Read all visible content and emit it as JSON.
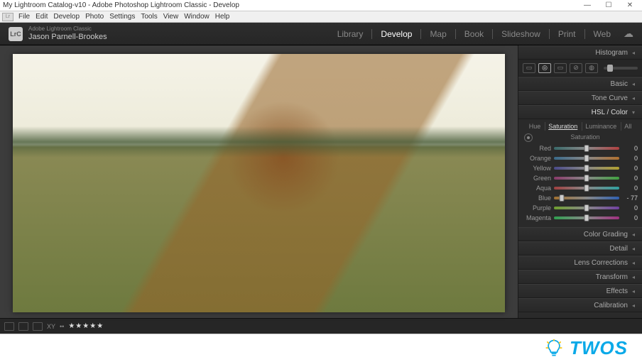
{
  "os": {
    "title": "My Lightroom Catalog-v10 - Adobe Photoshop Lightroom Classic - Develop",
    "min": "—",
    "max": "☐",
    "close": "✕"
  },
  "menu": {
    "items": [
      "File",
      "Edit",
      "Develop",
      "Photo",
      "Settings",
      "Tools",
      "View",
      "Window",
      "Help"
    ]
  },
  "header": {
    "logo_text": "LrC",
    "brand_small": "Adobe Lightroom Classic",
    "user": "Jason Parnell-Brookes",
    "modules": [
      "Library",
      "Develop",
      "Map",
      "Book",
      "Slideshow",
      "Print",
      "Web"
    ],
    "active_module": "Develop"
  },
  "right_panel": {
    "sections_top": [
      {
        "label": "Histogram",
        "chev": "◂"
      }
    ],
    "tools": [
      "▭",
      "◎",
      "▭",
      "⊘",
      "◍"
    ],
    "sections_mid": [
      {
        "label": "Basic",
        "chev": "◂"
      },
      {
        "label": "Tone Curve",
        "chev": "◂"
      },
      {
        "label": "HSL / Color",
        "chev": "▾",
        "active": true
      }
    ],
    "hsl": {
      "tabs": [
        "Hue",
        "Saturation",
        "Luminance",
        "All"
      ],
      "active_tab": "Saturation",
      "sub_label": "Saturation",
      "sliders": [
        {
          "name": "Red",
          "value": 0,
          "grad": "grad-red",
          "pos": 50
        },
        {
          "name": "Orange",
          "value": 0,
          "grad": "grad-orange",
          "pos": 50
        },
        {
          "name": "Yellow",
          "value": 0,
          "grad": "grad-yellow",
          "pos": 50
        },
        {
          "name": "Green",
          "value": 0,
          "grad": "grad-green",
          "pos": 50
        },
        {
          "name": "Aqua",
          "value": 0,
          "grad": "grad-aqua",
          "pos": 50
        },
        {
          "name": "Blue",
          "value": -77,
          "grad": "grad-blue",
          "pos": 12
        },
        {
          "name": "Purple",
          "value": 0,
          "grad": "grad-purple",
          "pos": 50
        },
        {
          "name": "Magenta",
          "value": 0,
          "grad": "grad-magenta",
          "pos": 50
        }
      ]
    },
    "sections_bottom": [
      {
        "label": "Color Grading",
        "chev": "◂"
      },
      {
        "label": "Detail",
        "chev": "◂"
      },
      {
        "label": "Lens Corrections",
        "chev": "◂"
      },
      {
        "label": "Transform",
        "chev": "◂"
      },
      {
        "label": "Effects",
        "chev": "◂"
      },
      {
        "label": "Calibration",
        "chev": "◂"
      }
    ]
  },
  "filmstrip": {
    "toggle_text": "XY",
    "info_dots": "••",
    "stars": "★★★★★"
  },
  "watermark": {
    "text": "TWOS"
  }
}
